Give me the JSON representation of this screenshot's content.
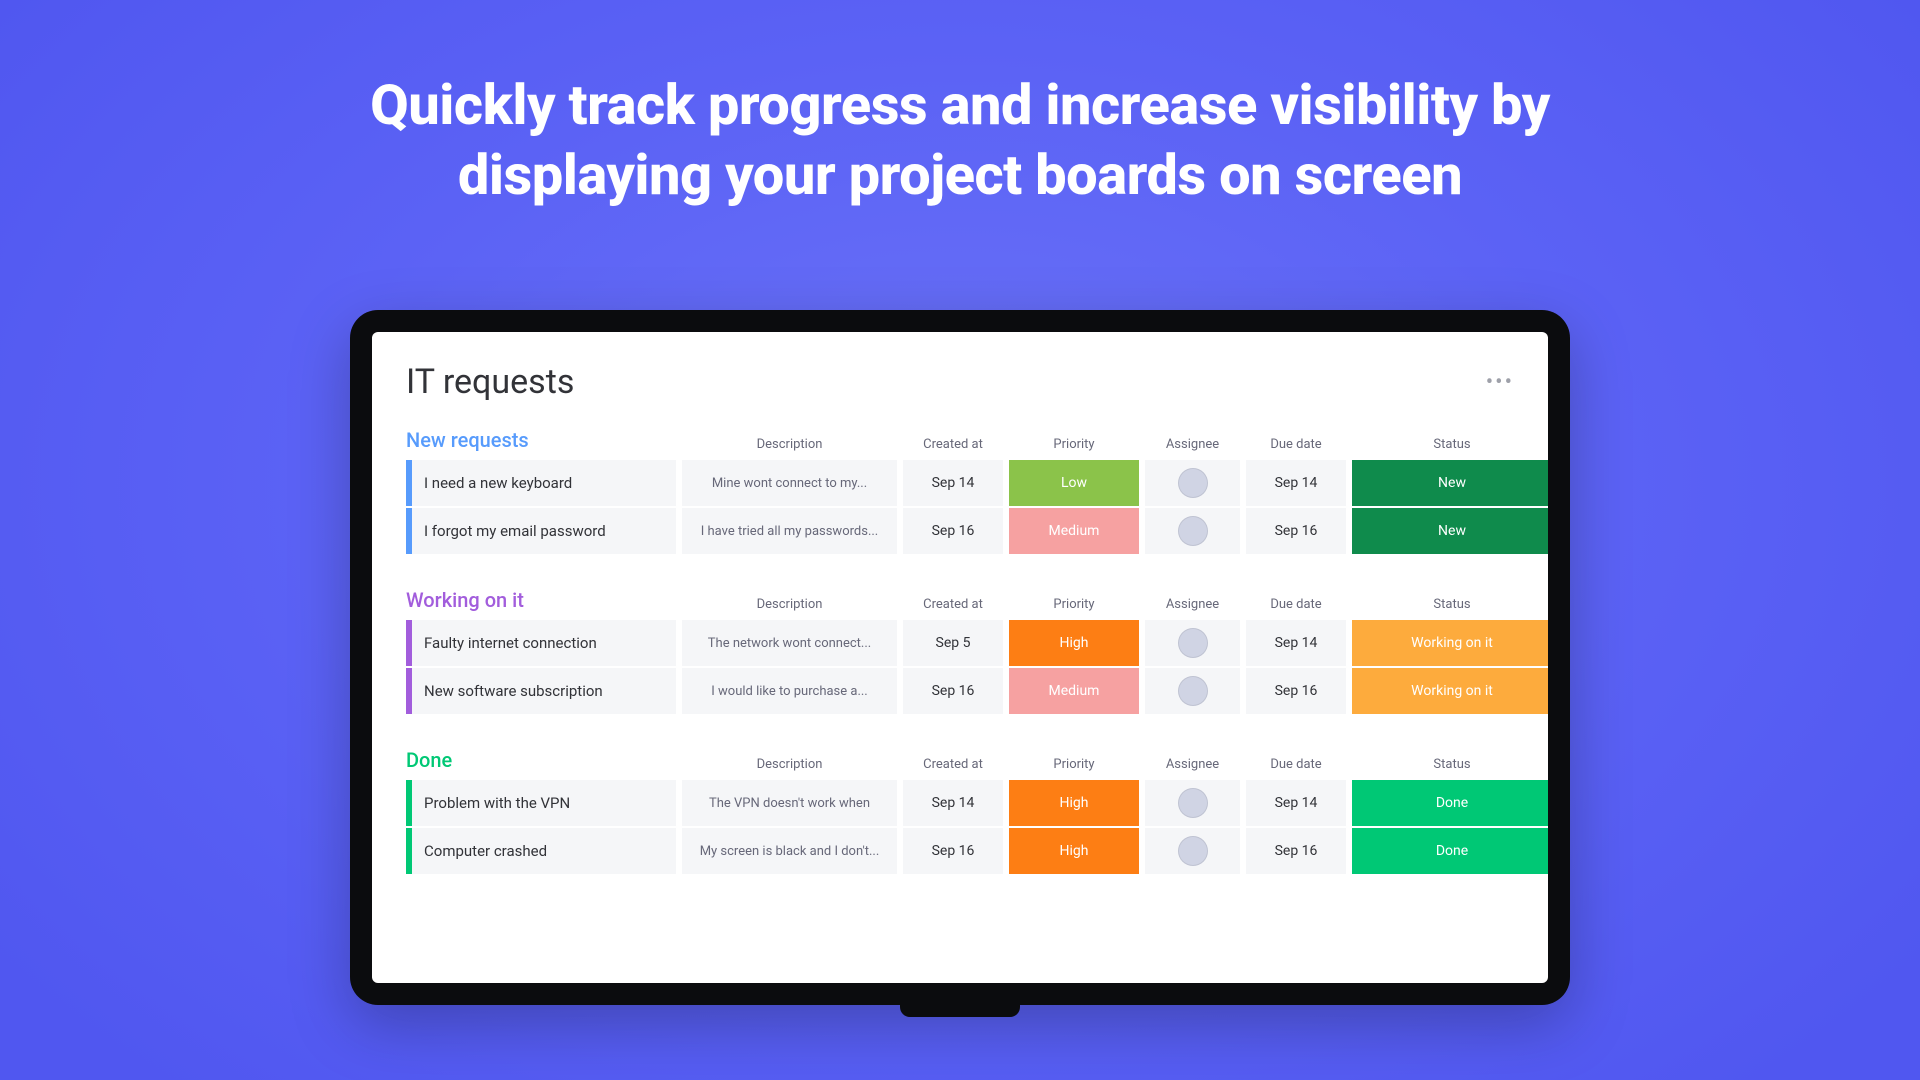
{
  "hero": {
    "line1": "Quickly track progress and increase visibility by",
    "line2": "displaying your project boards on screen"
  },
  "board": {
    "title": "IT requests",
    "more_icon": "more-icon"
  },
  "columns": {
    "description": "Description",
    "created_at": "Created at",
    "priority": "Priority",
    "assignee": "Assignee",
    "due_date": "Due date",
    "status": "Status"
  },
  "groups": [
    {
      "name": "New requests",
      "color_class": "gc-blue",
      "row_color": "#579bfc",
      "rows": [
        {
          "name": "I need a new keyboard",
          "description": "Mine wont connect to my...",
          "created_at": "Sep 14",
          "priority": "Low",
          "assignee_avatar": "av1",
          "due_date": "Sep 14",
          "status": "New"
        },
        {
          "name": "I forgot my email password",
          "description": "I have tried all my passwords...",
          "created_at": "Sep 16",
          "priority": "Medium",
          "assignee_avatar": "av2",
          "due_date": "Sep 16",
          "status": "New"
        }
      ]
    },
    {
      "name": "Working on it",
      "color_class": "gc-purple",
      "row_color": "#a25ddc",
      "rows": [
        {
          "name": "Faulty internet connection",
          "description": "The network wont connect...",
          "created_at": "Sep 5",
          "priority": "High",
          "assignee_avatar": "av3",
          "due_date": "Sep 14",
          "status": "Working on it"
        },
        {
          "name": "New software subscription",
          "description": "I would like to purchase a...",
          "created_at": "Sep 16",
          "priority": "Medium",
          "assignee_avatar": "av4",
          "due_date": "Sep 16",
          "status": "Working on it"
        }
      ]
    },
    {
      "name": "Done",
      "color_class": "gc-green",
      "row_color": "#00c875",
      "rows": [
        {
          "name": "Problem with the VPN",
          "description": "The VPN doesn't work when",
          "created_at": "Sep 14",
          "priority": "High",
          "assignee_avatar": "av5",
          "due_date": "Sep 14",
          "status": "Done"
        },
        {
          "name": "Computer crashed",
          "description": "My screen is black and I don't...",
          "created_at": "Sep 16",
          "priority": "High",
          "assignee_avatar": "av6",
          "due_date": "Sep 16",
          "status": "Done"
        }
      ]
    }
  ]
}
